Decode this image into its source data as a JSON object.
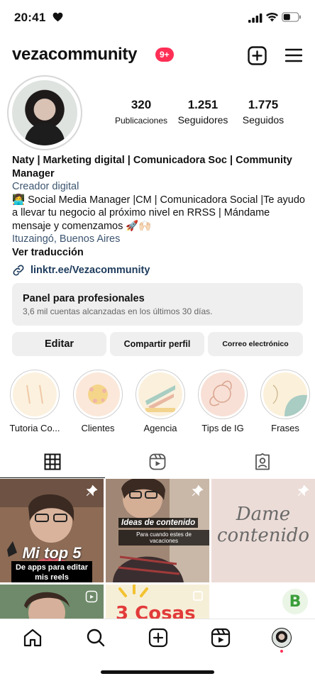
{
  "status_bar": {
    "time": "20:41",
    "icons": [
      "heart-icon",
      "signal-icon",
      "wifi-icon",
      "battery-icon"
    ]
  },
  "header": {
    "username": "vezacommunity",
    "notification_badge": "9+",
    "icons": [
      "new-post-icon",
      "menu-icon"
    ]
  },
  "profile": {
    "stats": [
      {
        "value": "320",
        "label": "Publicaciones"
      },
      {
        "value": "1.251",
        "label": "Seguidores"
      },
      {
        "value": "1.775",
        "label": "Seguidos"
      }
    ],
    "bio": {
      "name": "Naty | Marketing digital | Comunicadora Soc | Community Manager",
      "category": "Creador digital",
      "text": "👩‍💻 Social Media Manager |CM | Comunicadora Social |Te ayudo a llevar tu negocio al próximo nivel en RRSS | Mándame mensaje y comenzamos 🚀🙌🏻",
      "location": "Ituzaingó, Buenos Aires",
      "translate": "Ver traducción"
    },
    "link": "linktr.ee/Vezacommunity"
  },
  "pro_panel": {
    "title": "Panel para profesionales",
    "subtitle": "3,6 mil cuentas alcanzadas en los últimos 30 días."
  },
  "buttons": {
    "edit": "Editar",
    "share": "Compartir perfil",
    "email": "Correo electrónico"
  },
  "highlights": [
    {
      "label": "Tutoria Co..."
    },
    {
      "label": "Clientes"
    },
    {
      "label": "Agencia"
    },
    {
      "label": "Tips de IG"
    },
    {
      "label": "Frases"
    }
  ],
  "tabs": [
    "grid-icon",
    "reels-icon",
    "tagged-icon"
  ],
  "posts": [
    {
      "caption_big": "Mi top 5",
      "caption_small": "De apps para editar mis reels"
    },
    {
      "caption": "Ideas de contenido",
      "subcaption": "Para cuando estes de vacaciones"
    },
    {
      "script_text": "Dame contenido"
    },
    {},
    {
      "caption": "3 Cosas"
    },
    {}
  ],
  "bottom_nav": [
    "home-icon",
    "search-icon",
    "create-icon",
    "reels-icon",
    "profile-avatar"
  ],
  "colors": {
    "badge": "#ff2e55",
    "link": "#1d3b5c",
    "button_bg": "#efefef"
  }
}
